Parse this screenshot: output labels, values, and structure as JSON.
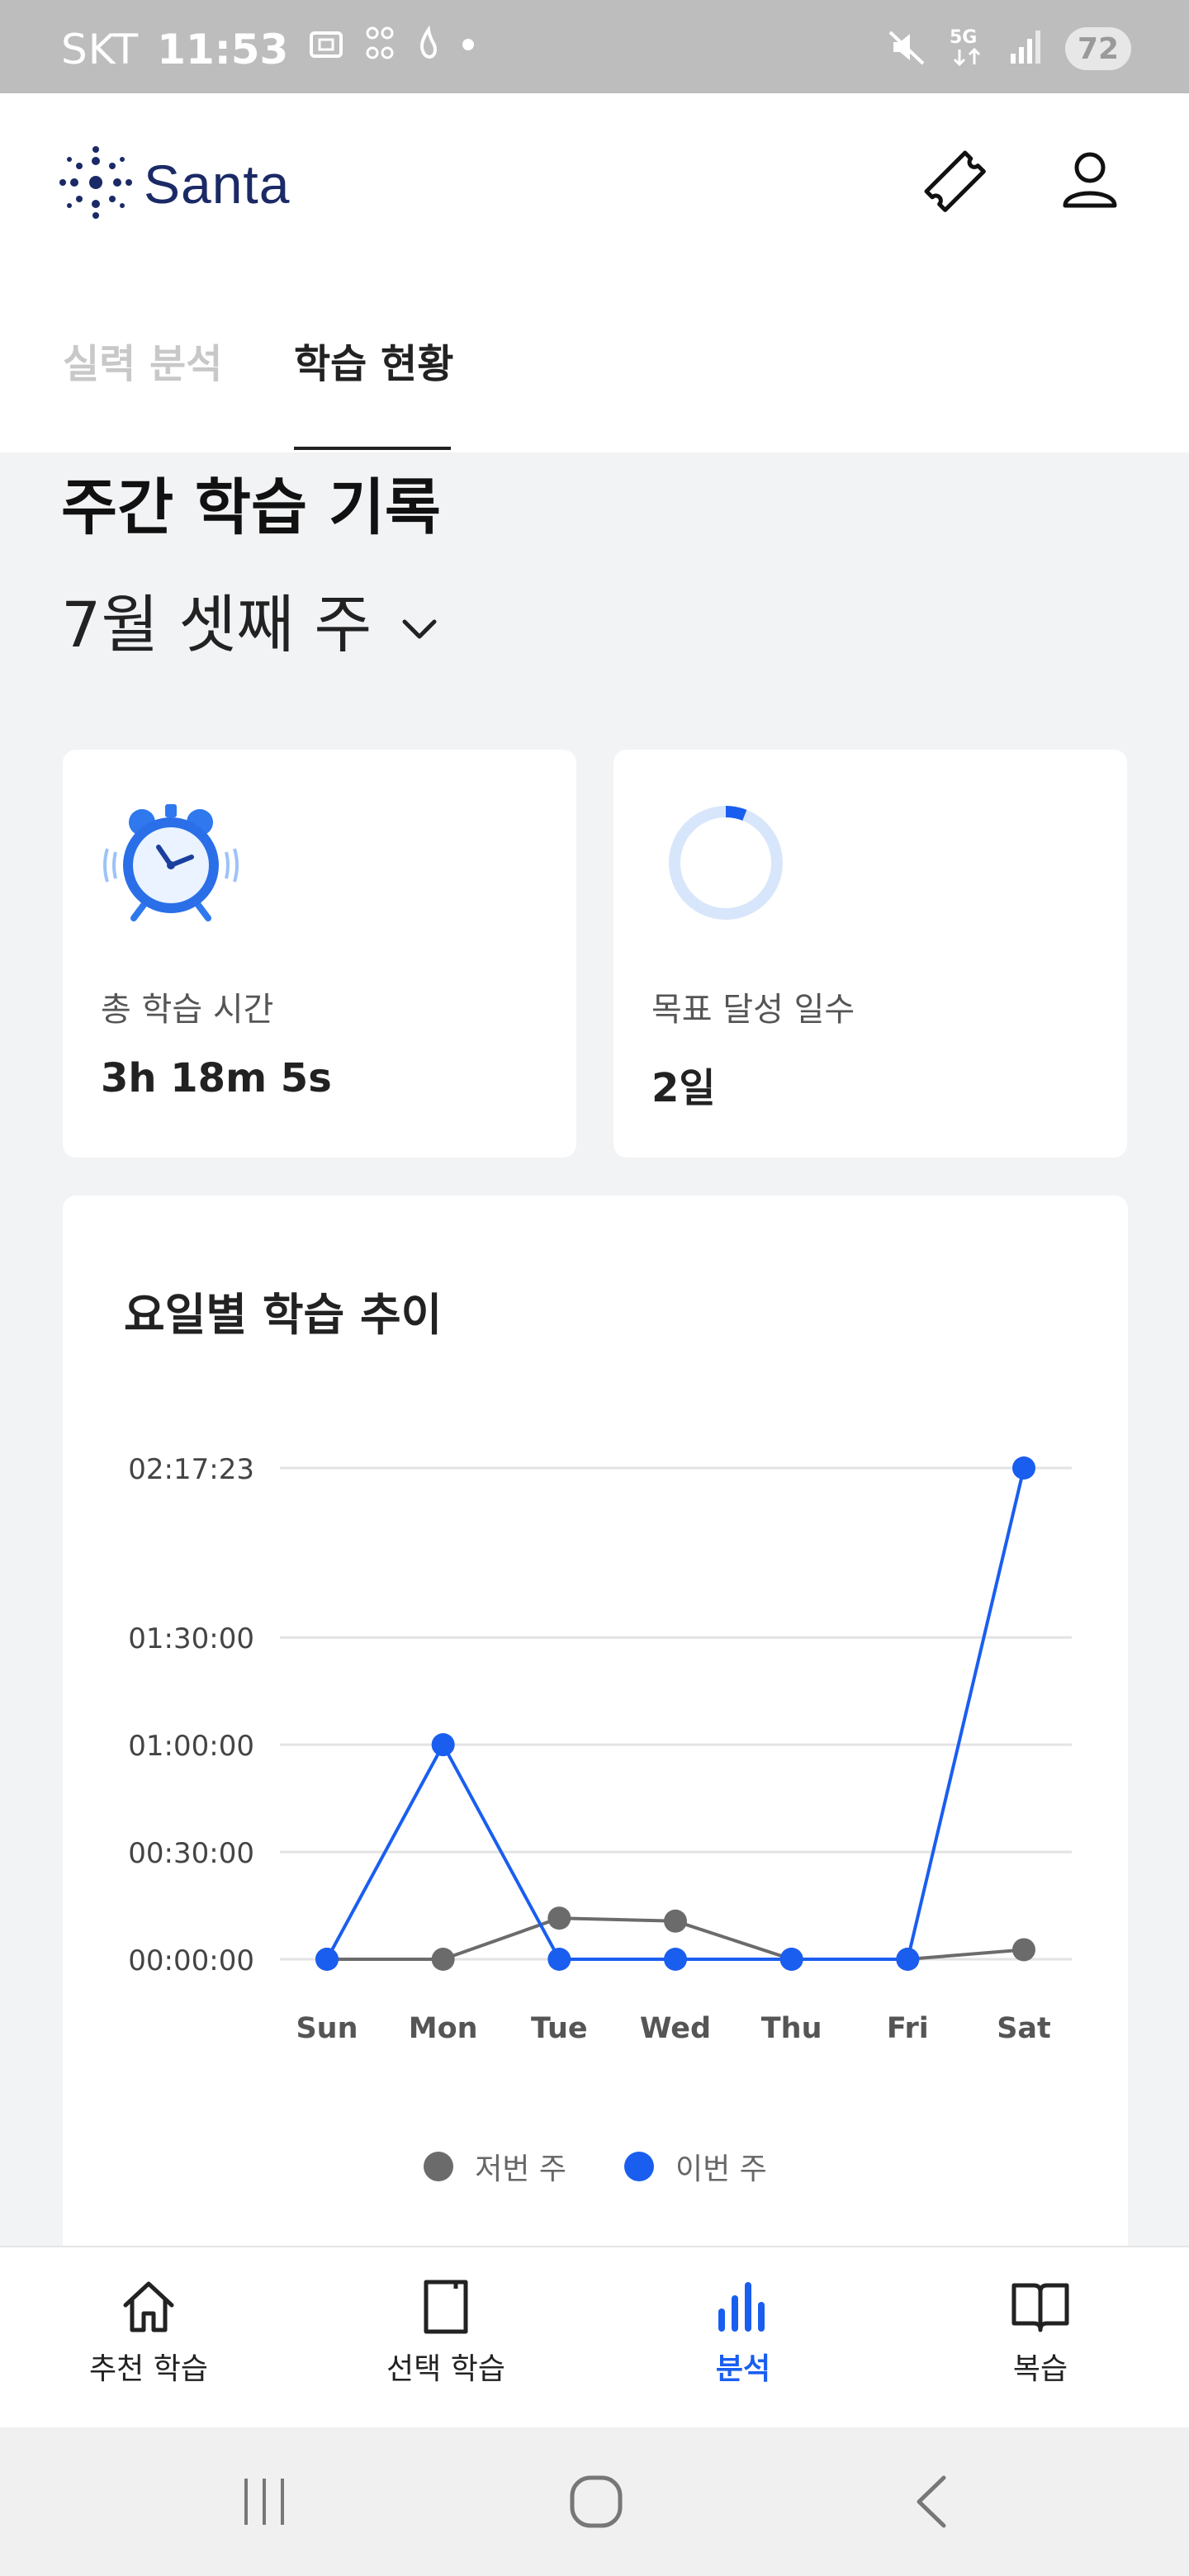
{
  "status_bar": {
    "carrier": "SKT",
    "time": "11:53",
    "network": "5G",
    "battery": "72"
  },
  "header": {
    "brand": "Santa",
    "tabs": [
      {
        "label": "실력 분석",
        "active": false
      },
      {
        "label": "학습 현황",
        "active": true
      }
    ]
  },
  "main": {
    "section_title": "주간 학습 기록",
    "week_label": "7월 셋째 주",
    "stats": [
      {
        "icon": "alarm-clock-icon",
        "label": "총 학습 시간",
        "value": "3h 18m 5s"
      },
      {
        "icon": "progress-ring-icon",
        "label": "목표 달성 일수",
        "value": "2일",
        "progress": 0.06
      }
    ]
  },
  "chart_data": {
    "type": "line",
    "title": "요일별 학습 추이",
    "categories": [
      "Sun",
      "Mon",
      "Tue",
      "Wed",
      "Thu",
      "Fri",
      "Sat"
    ],
    "y_ticks": [
      "00:00:00",
      "00:30:00",
      "01:00:00",
      "01:30:00",
      "02:17:23"
    ],
    "y_tick_values": [
      0,
      1800,
      3600,
      5400,
      8243
    ],
    "ylim": [
      0,
      8243
    ],
    "grid": true,
    "legend_position": "bottom",
    "series": [
      {
        "name": "저번 주",
        "color": "#6b6b6b",
        "values": [
          0,
          0,
          690,
          640,
          0,
          0,
          160
        ]
      },
      {
        "name": "이번 주",
        "color": "#1a5ef0",
        "values": [
          0,
          3600,
          0,
          0,
          0,
          0,
          8243
        ]
      }
    ]
  },
  "bottom_nav": {
    "items": [
      {
        "label": "추천 학습",
        "icon": "home-icon",
        "active": false
      },
      {
        "label": "선택 학습",
        "icon": "notebook-icon",
        "active": false
      },
      {
        "label": "분석",
        "icon": "bar-chart-icon",
        "active": true
      },
      {
        "label": "복습",
        "icon": "book-icon",
        "active": false
      }
    ]
  },
  "colors": {
    "accent": "#1a5ef0",
    "brand": "#1b2a66",
    "background": "#f2f3f5"
  }
}
